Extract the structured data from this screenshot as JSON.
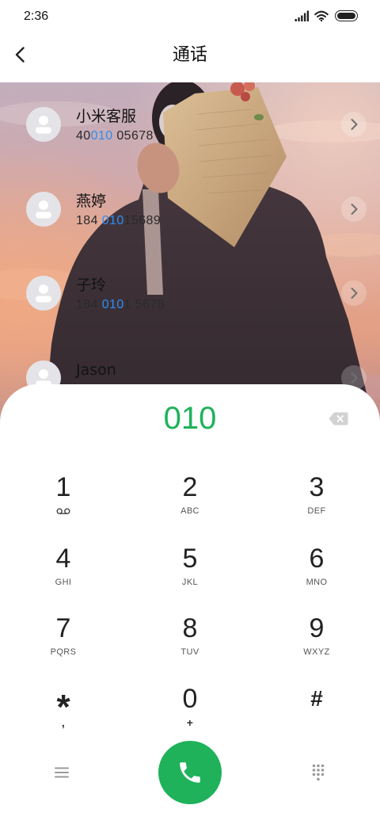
{
  "status_bar": {
    "time": "2:36",
    "battery_level": 1.0,
    "icons": [
      "signal-icon",
      "wifi-icon",
      "battery-icon"
    ]
  },
  "header": {
    "title": "通话",
    "back_icon": "back-arrow-icon"
  },
  "contacts": [
    {
      "name": "小米客服",
      "number": {
        "before": "40",
        "match": "010",
        "after": " 05678"
      },
      "avatar_icon": "default-avatar-icon",
      "action_icon": "chevron-right-icon"
    },
    {
      "name": "燕婷",
      "number": {
        "before": "184 ",
        "match": "010",
        "after": "15689"
      },
      "avatar_icon": "default-avatar-icon",
      "action_icon": "chevron-right-icon"
    },
    {
      "name": "子玲",
      "number": {
        "before": "184 ",
        "match": "010",
        "after": "1 5678"
      },
      "avatar_icon": "default-avatar-icon",
      "action_icon": "chevron-right-icon"
    },
    {
      "name": "Jason",
      "avatar_icon": "default-avatar-icon",
      "action_icon": "chevron-right-icon"
    }
  ],
  "dialer": {
    "input_value": "010",
    "backspace_icon": "backspace-icon"
  },
  "keypad": [
    {
      "digit": "1",
      "sub_icon": "voicemail-icon"
    },
    {
      "digit": "2",
      "sub": "ABC"
    },
    {
      "digit": "3",
      "sub": "DEF"
    },
    {
      "digit": "4",
      "sub": "GHI"
    },
    {
      "digit": "5",
      "sub": "JKL"
    },
    {
      "digit": "6",
      "sub": "MNO"
    },
    {
      "digit": "7",
      "sub": "PQRS"
    },
    {
      "digit": "8",
      "sub": "TUV"
    },
    {
      "digit": "9",
      "sub": "WXYZ"
    },
    {
      "digit": "*",
      "sub": ","
    },
    {
      "digit": "0",
      "sub": "+"
    },
    {
      "digit": "#"
    }
  ],
  "bottom_bar": {
    "left_icon": "menu-icon",
    "call_icon": "phone-icon",
    "right_icon": "dialpad-icon"
  },
  "colors": {
    "accent_green": "#1fb25a",
    "match_blue": "#2b8ef3",
    "text_primary": "#111111",
    "keypad_sub": "#555555",
    "icon_gray": "#9a9a9a"
  }
}
